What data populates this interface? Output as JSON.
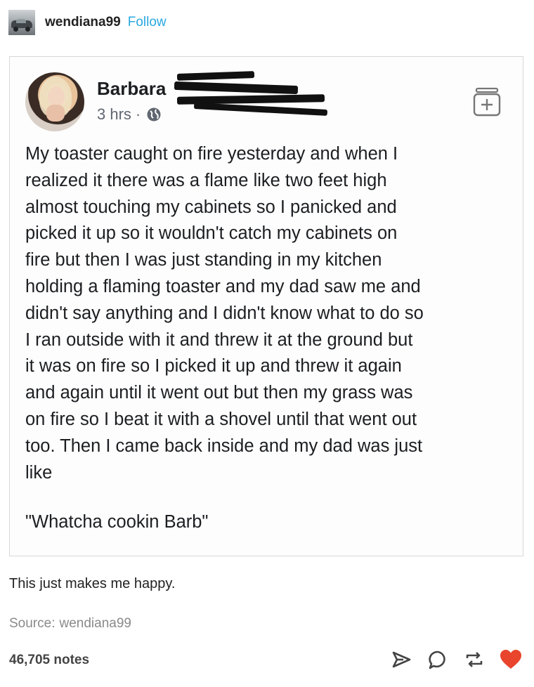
{
  "reblog_header": {
    "username": "wendiana99",
    "follow_label": "Follow"
  },
  "screenshot_post": {
    "author_first_name": "Barbara",
    "time": "3 hrs",
    "separator": "·",
    "privacy_icon": "globe-icon",
    "add_icon": "add-to-album-icon",
    "body": "My toaster caught on fire yesterday and when I\nrealized it there was a flame like two feet high\nalmost touching my cabinets so I panicked and\npicked it up so it wouldn't catch my cabinets on\nfire but then I was just standing in my kitchen\nholding a flaming toaster and my dad saw me and\ndidn't say anything and I didn't know what to do so\nI ran outside with it and threw it at the ground but\nit was on fire so I picked it up and threw it again\nand again until it went out but then my grass was\non fire so I beat it with a shovel until that went out\ntoo. Then I came back inside and my dad was just\nlike",
    "quote": "\"Whatcha cookin Barb\""
  },
  "caption": "This just makes me happy.",
  "source": {
    "label": "Source:",
    "name": "wendiana99"
  },
  "footer": {
    "notes": "46,705 notes",
    "actions": [
      "share-icon",
      "reply-icon",
      "reblog-icon",
      "like-icon"
    ]
  },
  "colors": {
    "follow": "#2aa7e0",
    "like": "#e8452c",
    "meta": "#606770"
  }
}
